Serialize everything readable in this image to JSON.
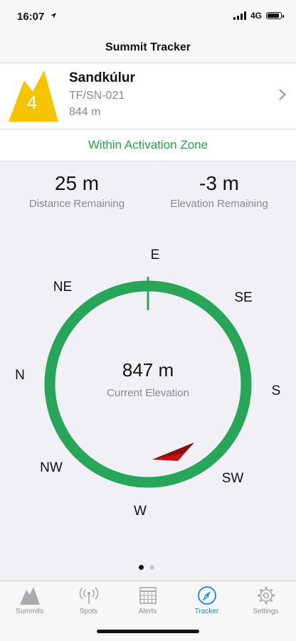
{
  "status": {
    "time": "16:07",
    "network": "4G",
    "battery_level": 0.9
  },
  "nav": {
    "title": "Summit Tracker"
  },
  "summit": {
    "points": "4",
    "name": "Sandkúlur",
    "reference": "TF/SN-021",
    "altitude": "844 m",
    "badge_color": "#f5c400"
  },
  "zone": {
    "text": "Within Activation Zone",
    "color": "#27a34a"
  },
  "stats": {
    "distance_value": "25 m",
    "distance_label": "Distance Remaining",
    "elevation_value": "-3 m",
    "elevation_label": "Elevation Remaining"
  },
  "compass": {
    "directions": {
      "N": "N",
      "NE": "NE",
      "E": "E",
      "SE": "SE",
      "S": "S",
      "SW": "SW",
      "W": "W",
      "NW": "NW"
    },
    "elevation_value": "847 m",
    "elevation_label": "Current Elevation",
    "ring_color": "#27a65a",
    "arrow_color": "#c8101a"
  },
  "pager": {
    "pages": 2,
    "current": 1
  },
  "tabs": [
    {
      "label": "Summits",
      "icon": "mountain-icon"
    },
    {
      "label": "Spots",
      "icon": "broadcast-icon"
    },
    {
      "label": "Alerts",
      "icon": "calendar-icon"
    },
    {
      "label": "Tracker",
      "icon": "compass-icon",
      "active": true
    },
    {
      "label": "Settings",
      "icon": "gear-icon"
    }
  ]
}
